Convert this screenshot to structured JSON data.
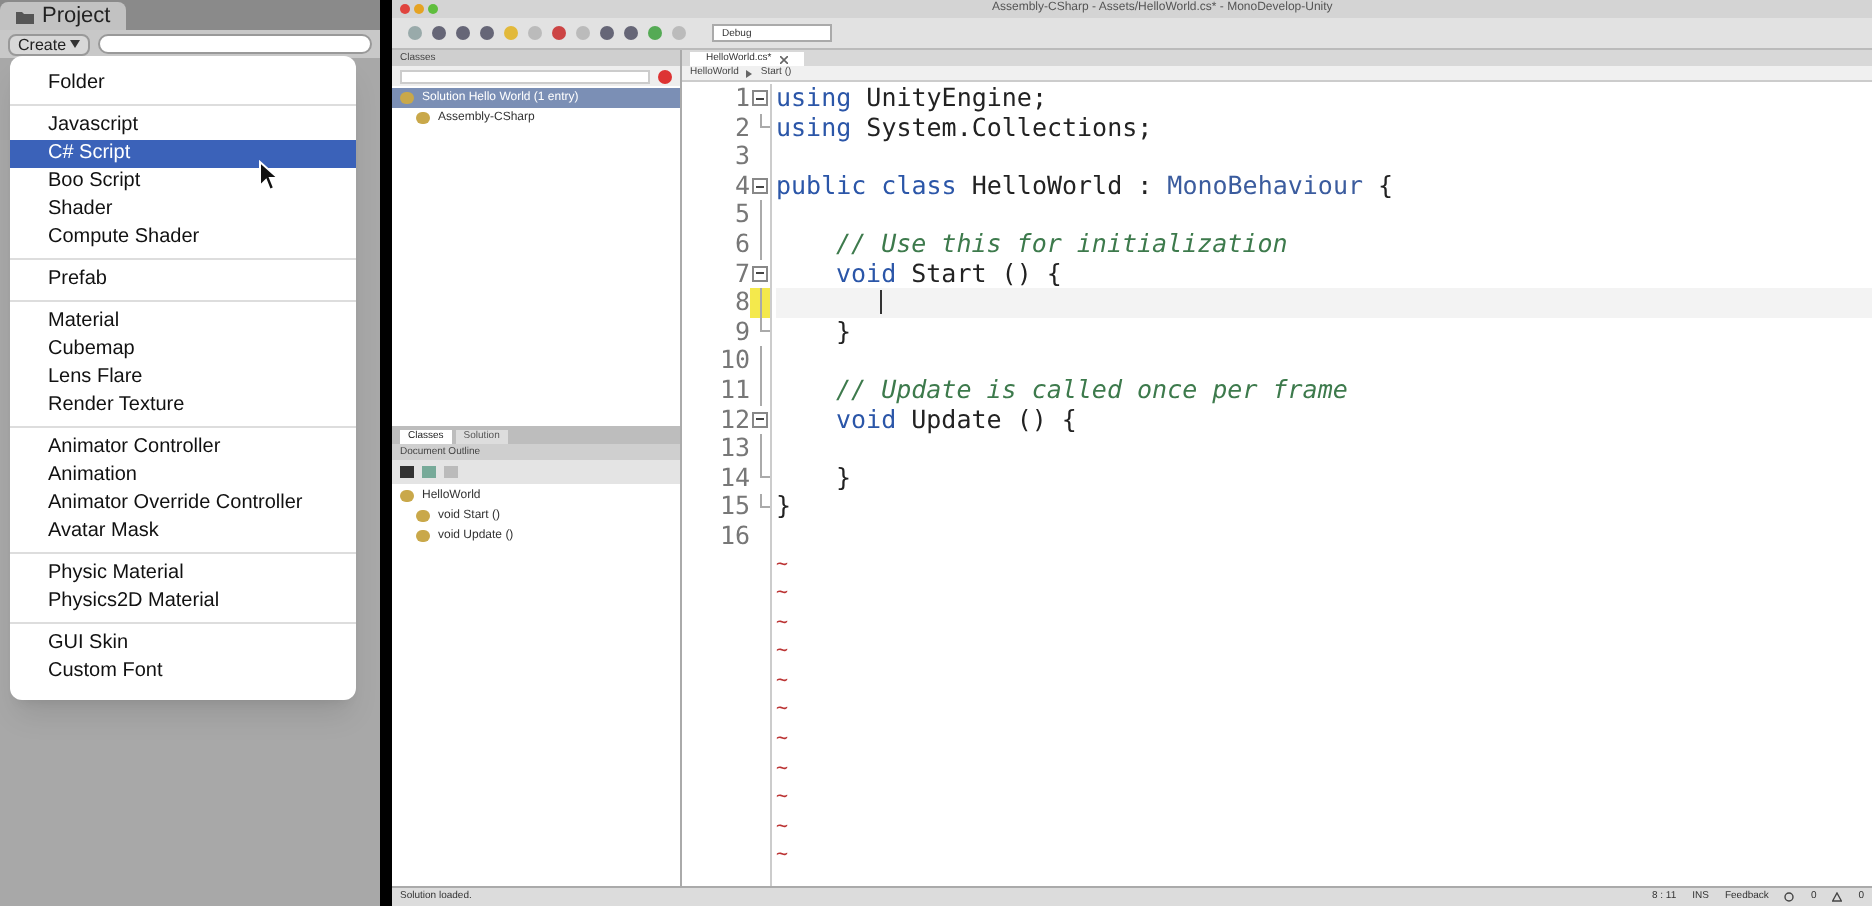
{
  "project_panel": {
    "tab": "Project",
    "create_button": "Create"
  },
  "create_menu": {
    "groups": [
      [
        {
          "label": "Folder",
          "selected": false
        }
      ],
      [
        {
          "label": "Javascript",
          "selected": false
        },
        {
          "label": "C# Script",
          "selected": true
        },
        {
          "label": "Boo Script",
          "selected": false
        },
        {
          "label": "Shader",
          "selected": false
        },
        {
          "label": "Compute Shader",
          "selected": false
        }
      ],
      [
        {
          "label": "Prefab",
          "selected": false
        }
      ],
      [
        {
          "label": "Material",
          "selected": false
        },
        {
          "label": "Cubemap",
          "selected": false
        },
        {
          "label": "Lens Flare",
          "selected": false
        },
        {
          "label": "Render Texture",
          "selected": false
        }
      ],
      [
        {
          "label": "Animator Controller",
          "selected": false
        },
        {
          "label": "Animation",
          "selected": false
        },
        {
          "label": "Animator Override Controller",
          "selected": false
        },
        {
          "label": "Avatar Mask",
          "selected": false
        }
      ],
      [
        {
          "label": "Physic Material",
          "selected": false
        },
        {
          "label": "Physics2D Material",
          "selected": false
        }
      ],
      [
        {
          "label": "GUI Skin",
          "selected": false
        },
        {
          "label": "Custom Font",
          "selected": false
        }
      ]
    ]
  },
  "window": {
    "title": "Assembly-CSharp - Assets/HelloWorld.cs* - MonoDevelop-Unity"
  },
  "toolbar": {
    "configuration": "Debug"
  },
  "classes_pad": {
    "title": "Classes",
    "tree": [
      {
        "label": "Solution Hello World (1 entry)",
        "selected": true,
        "children": [
          {
            "label": "Assembly-CSharp",
            "selected": false
          }
        ]
      }
    ],
    "tabs": [
      {
        "label": "Classes",
        "selected": true
      },
      {
        "label": "Solution",
        "selected": false
      }
    ]
  },
  "outline_pad": {
    "title": "Document Outline",
    "tree": [
      {
        "label": "HelloWorld",
        "children": [
          {
            "label": "void Start ()"
          },
          {
            "label": "void Update ()"
          }
        ]
      }
    ]
  },
  "editor": {
    "tab": "HelloWorld.cs*",
    "breadcrumb": [
      "HelloWorld",
      "Start ()"
    ],
    "lines": [
      {
        "number": "1",
        "kind": "fold_start",
        "current": false,
        "tokens": [
          {
            "text": "using",
            "kind": "keyword"
          },
          {
            "text": " UnityEngine;",
            "kind": "plain"
          }
        ]
      },
      {
        "number": "2",
        "kind": "fold_end",
        "current": false,
        "tokens": [
          {
            "text": "using",
            "kind": "keyword"
          },
          {
            "text": " System.Collections;",
            "kind": "plain"
          }
        ]
      },
      {
        "number": "3",
        "kind": "plain",
        "current": false
      },
      {
        "number": "4",
        "kind": "fold_start",
        "current": false,
        "tokens": [
          {
            "text": "public class",
            "kind": "keyword"
          },
          {
            "text": " HelloWorld : ",
            "kind": "plain"
          },
          {
            "text": "MonoBehaviour",
            "kind": "type"
          },
          {
            "text": " {",
            "kind": "plain"
          }
        ]
      },
      {
        "number": "5",
        "kind": "fold_inside",
        "current": false
      },
      {
        "number": "6",
        "kind": "fold_inside",
        "current": false,
        "indented": true,
        "tokens": [
          {
            "text": "// Use this for initialization",
            "kind": "comment"
          }
        ]
      },
      {
        "number": "7",
        "kind": "fold_start",
        "current": false,
        "indented": true,
        "tokens": [
          {
            "text": "void",
            "kind": "keyword"
          },
          {
            "text": " Start () {",
            "kind": "plain"
          }
        ]
      },
      {
        "number": "8",
        "kind": "fold_inside",
        "current": true
      },
      {
        "number": "9",
        "kind": "fold_end",
        "current": false,
        "indented": true,
        "tokens": [
          {
            "text": "}",
            "kind": "plain"
          }
        ]
      },
      {
        "number": "10",
        "kind": "fold_inside",
        "current": false
      },
      {
        "number": "11",
        "kind": "fold_inside",
        "current": false,
        "indented": true,
        "tokens": [
          {
            "text": "// Update is called once per frame",
            "kind": "comment"
          }
        ]
      },
      {
        "number": "12",
        "kind": "fold_start",
        "current": false,
        "indented": true,
        "tokens": [
          {
            "text": "void",
            "kind": "keyword"
          },
          {
            "text": " Update () {",
            "kind": "plain"
          }
        ]
      },
      {
        "number": "13",
        "kind": "fold_inside",
        "current": false
      },
      {
        "number": "14",
        "kind": "fold_end",
        "current": false,
        "indented": true,
        "tokens": [
          {
            "text": "}",
            "kind": "plain"
          }
        ]
      },
      {
        "number": "15",
        "kind": "fold_end",
        "current": false,
        "tokens": [
          {
            "text": "}",
            "kind": "plain"
          }
        ]
      },
      {
        "number": "16",
        "kind": "plain",
        "current": false
      }
    ],
    "end_markers": [
      "~",
      "~",
      "~",
      "~",
      "~",
      "~",
      "~",
      "~",
      "~",
      "~",
      "~"
    ]
  },
  "status_bar": {
    "message": "Solution loaded.",
    "position": "8 : 11",
    "mode": "INS",
    "feedback": "Feedback",
    "errors": "0",
    "warnings": "0"
  }
}
